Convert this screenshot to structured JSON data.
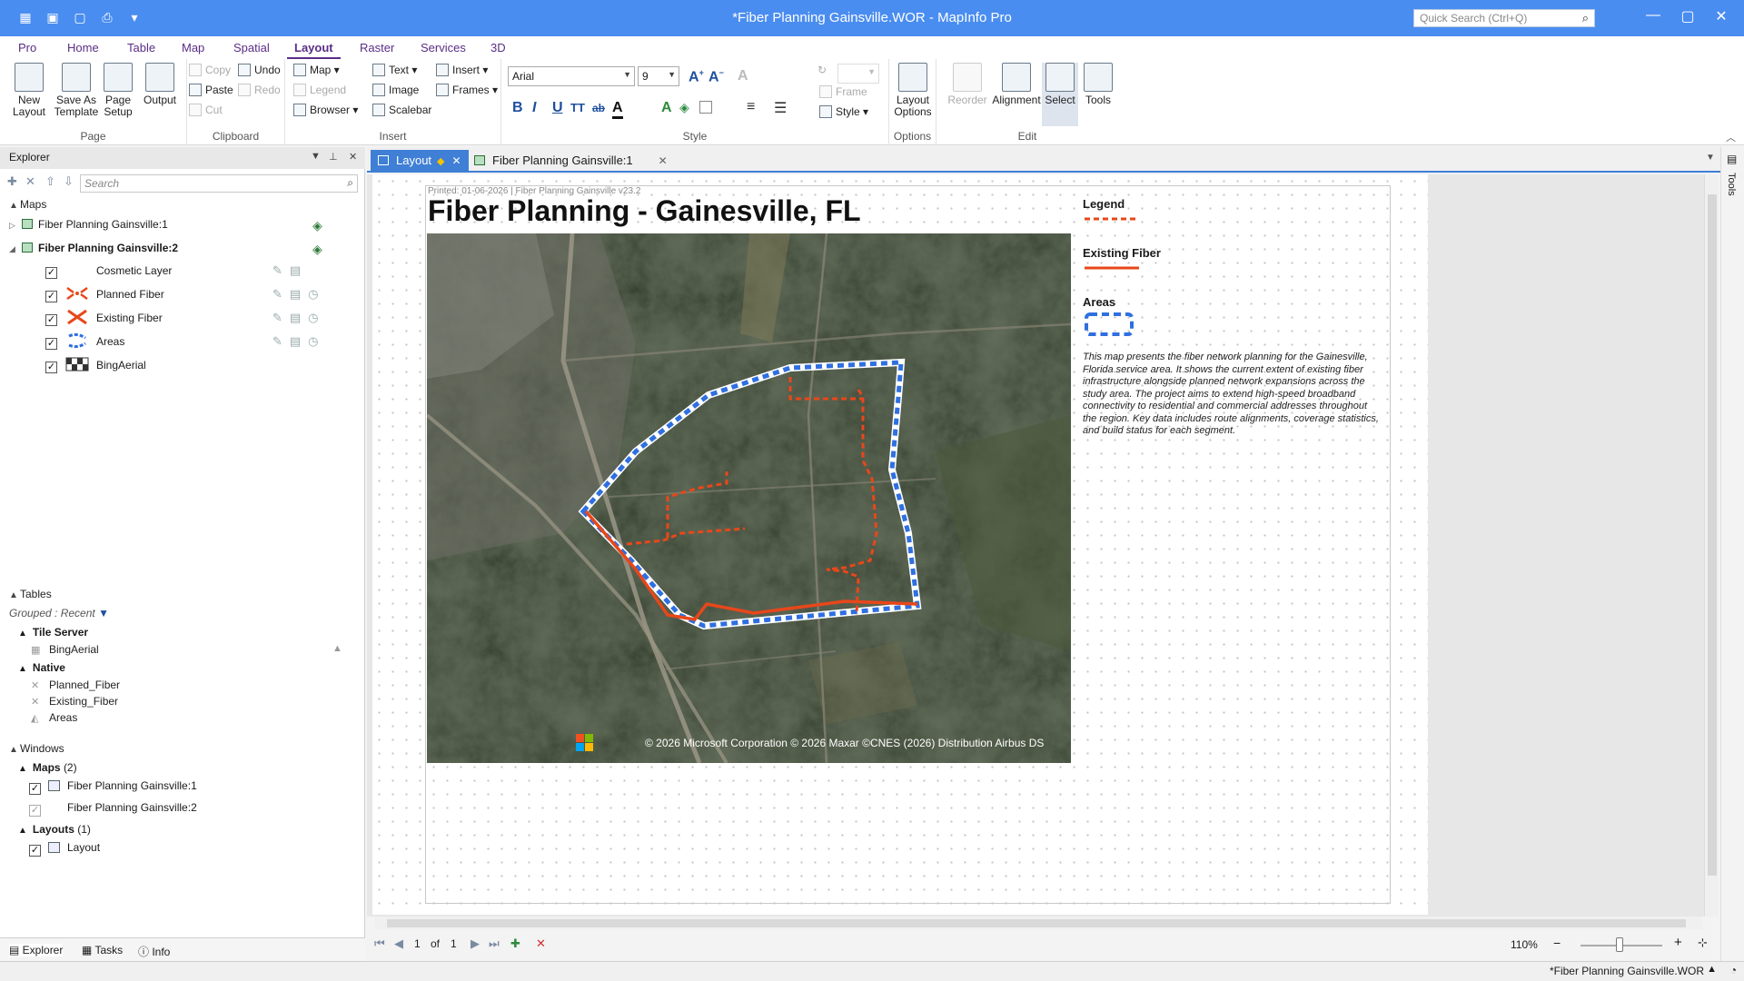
{
  "titlebar": {
    "title": "*Fiber Planning Gainsville.WOR - MapInfo Pro",
    "quick_search_placeholder": "Quick Search (Ctrl+Q)"
  },
  "ribbon_tabs": [
    "Pro",
    "Home",
    "Table",
    "Map",
    "Spatial",
    "Layout",
    "Raster",
    "Services",
    "3D"
  ],
  "ribbon_active_tab": "Layout",
  "ribbon": {
    "page": {
      "new_layout": "New Layout",
      "save_as_template": "Save As Template",
      "page_setup": "Page Setup",
      "output": "Output",
      "label": "Page"
    },
    "clipboard": {
      "copy": "Copy",
      "paste": "Paste",
      "cut": "Cut",
      "undo": "Undo",
      "redo": "Redo",
      "label": "Clipboard"
    },
    "insert": {
      "map": "Map",
      "legend": "Legend",
      "browser": "Browser",
      "text": "Text",
      "image": "Image",
      "scalebar": "Scalebar",
      "insert": "Insert",
      "frames": "Frames",
      "label": "Insert"
    },
    "style": {
      "font": "Arial",
      "size": "9",
      "label": "Style",
      "frame": "Frame",
      "style_btn": "Style"
    },
    "options": {
      "layout_options": "Layout Options",
      "label": "Options"
    },
    "edit": {
      "reorder": "Reorder",
      "alignment": "Alignment",
      "select": "Select",
      "tools": "Tools",
      "label": "Edit"
    }
  },
  "explorer": {
    "title": "Explorer",
    "search_placeholder": "Search",
    "maps_section": "Maps",
    "maps": [
      {
        "name": "Fiber Planning Gainsville:1",
        "expanded": false
      },
      {
        "name": "Fiber Planning Gainsville:2",
        "expanded": true
      }
    ],
    "layers": [
      {
        "name": "Cosmetic Layer",
        "checked": true
      },
      {
        "name": "Planned Fiber",
        "checked": true
      },
      {
        "name": "Existing Fiber",
        "checked": true
      },
      {
        "name": "Areas",
        "checked": true
      },
      {
        "name": "BingAerial",
        "checked": true
      }
    ],
    "tables_section": "Tables",
    "grouped_label": "Grouped : Recent",
    "tile_server_group": "Tile Server",
    "tile_server_tables": [
      "BingAerial"
    ],
    "native_group": "Native",
    "native_tables": [
      "Planned_Fiber",
      "Existing_Fiber",
      "Areas"
    ],
    "windows_section": "Windows",
    "maps_group": "Maps",
    "maps_count": "(2)",
    "window_maps": [
      "Fiber Planning Gainsville:1",
      "Fiber Planning Gainsville:2"
    ],
    "layouts_group": "Layouts",
    "layouts_count": "(1)",
    "window_layouts": [
      "Layout"
    ],
    "bottom_tabs": [
      "Explorer",
      "Tasks",
      "Info"
    ]
  },
  "doc_tabs": [
    {
      "label": "Layout",
      "active": true
    },
    {
      "label": "Fiber Planning Gainsville:1",
      "active": false
    }
  ],
  "layout": {
    "printed_line": "Printed: 01-06-2026  |  Fiber Planning Gainsville v23.2",
    "map_title": "Fiber Planning - Gainesville, FL",
    "attribution": "© 2026 Microsoft Corporation © 2026 Maxar ©CNES (2026) Distribution Airbus DS",
    "legend_title": "Legend",
    "legend_items": [
      {
        "label": "Existing Fiber",
        "color": "#e8471a"
      },
      {
        "label": "Areas",
        "color": "#2f6fe0"
      }
    ],
    "planned_color": "#e8471a",
    "description": "This map presents the fiber network planning for the Gainesville, Florida service area. It shows the current extent of existing fiber infrastructure alongside planned network expansions across the study area. The project aims to extend high-speed broadband connectivity to residential and commercial addresses throughout the region. Key data includes route alignments, coverage statistics, and build status for each segment."
  },
  "pagenav": {
    "page": "1",
    "of": "of",
    "total": "1"
  },
  "zoom": "110%",
  "status": "*Fiber Planning Gainsville.WOR",
  "tools_label": "Tools"
}
